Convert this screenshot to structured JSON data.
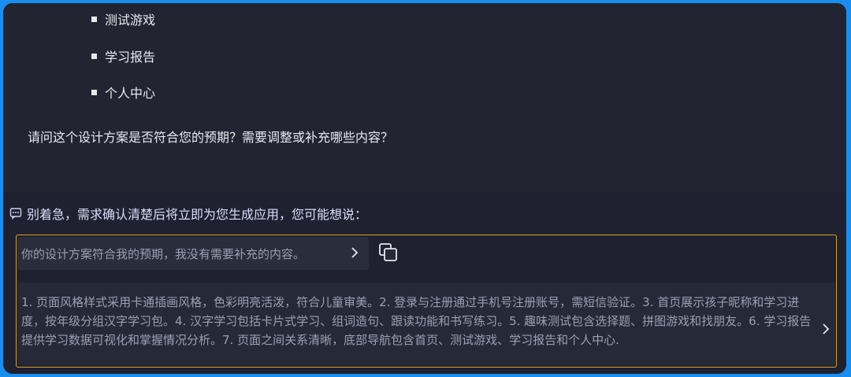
{
  "chat": {
    "bullets": [
      "测试游戏",
      "学习报告",
      "个人中心"
    ],
    "question": "请问这个设计方案是否符合您的预期？需要调整或补充哪些内容？"
  },
  "suggestions": {
    "header": "别着急，需求确认清楚后将立即为您生成应用，您可能想说：",
    "header_icon": "chat-bubble-icon",
    "items": [
      "你的设计方案符合我的预期，我没有需要补充的内容。",
      "1. 页面风格样式采用卡通插画风格，色彩明亮活泼，符合儿童审美。2. 登录与注册通过手机号注册账号，需短信验证。3. 首页展示孩子昵称和学习进度，按年级分组汉字学习包。4. 汉字学习包括卡片式学习、组词造句、跟读功能和书写练习。5. 趣味测试包含选择题、拼图游戏和找朋友。6. 学习报告提供学习数据可视化和掌握情况分析。7. 页面之间关系清晰，底部导航包含首页、测试游戏、学习报告和个人中心."
    ],
    "accent_color": "#d8a21d"
  }
}
